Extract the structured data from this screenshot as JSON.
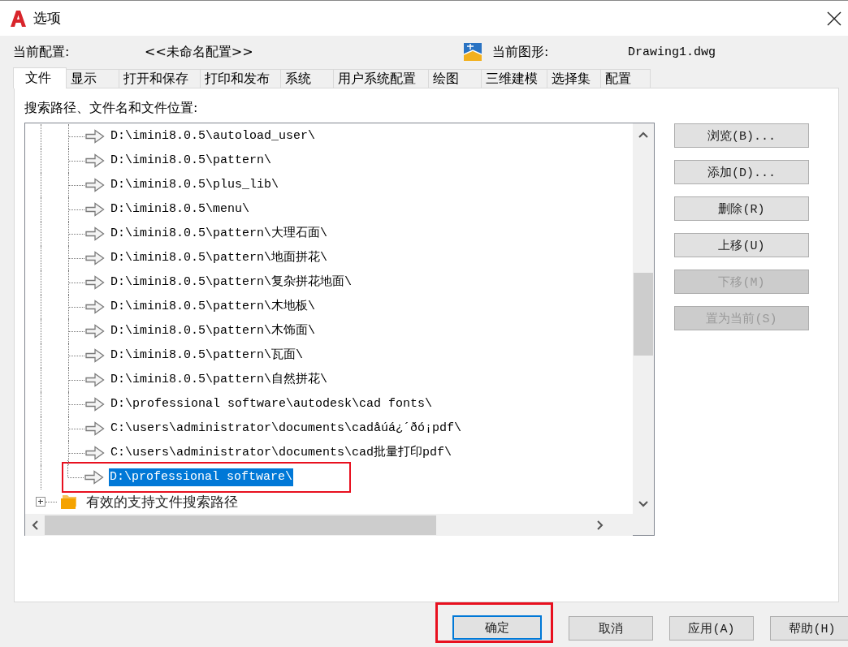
{
  "window": {
    "title": "选项"
  },
  "header": {
    "profile_label": "当前配置:",
    "profile_value": "<<未命名配置>>",
    "drawing_label": "当前图形:",
    "drawing_value": "Drawing1.dwg"
  },
  "tabs": [
    {
      "label": "文件",
      "selected": true
    },
    {
      "label": "显示",
      "selected": false
    },
    {
      "label": "打开和保存",
      "selected": false
    },
    {
      "label": "打印和发布",
      "selected": false
    },
    {
      "label": "系统",
      "selected": false
    },
    {
      "label": "用户系统配置",
      "selected": false
    },
    {
      "label": "绘图",
      "selected": false
    },
    {
      "label": "三维建模",
      "selected": false
    },
    {
      "label": "选择集",
      "selected": false
    },
    {
      "label": "配置",
      "selected": false
    }
  ],
  "panel_label": "搜索路径、文件名和文件位置:",
  "tree": {
    "items": [
      {
        "kind": "continued",
        "children": [
          {
            "label": "D:\\imini8.0.5\\autoload_user\\",
            "selected": false,
            "marked": false
          },
          {
            "label": "D:\\imini8.0.5\\pattern\\",
            "selected": false,
            "marked": false
          },
          {
            "label": "D:\\imini8.0.5\\plus_lib\\",
            "selected": false,
            "marked": false
          },
          {
            "label": "D:\\imini8.0.5\\menu\\",
            "selected": false,
            "marked": false
          },
          {
            "label": "D:\\imini8.0.5\\pattern\\大理石面\\",
            "selected": false,
            "marked": false
          },
          {
            "label": "D:\\imini8.0.5\\pattern\\地面拼花\\",
            "selected": false,
            "marked": false
          },
          {
            "label": "D:\\imini8.0.5\\pattern\\复杂拼花地面\\",
            "selected": false,
            "marked": false
          },
          {
            "label": "D:\\imini8.0.5\\pattern\\木地板\\",
            "selected": false,
            "marked": false
          },
          {
            "label": "D:\\imini8.0.5\\pattern\\木饰面\\",
            "selected": false,
            "marked": false
          },
          {
            "label": "D:\\imini8.0.5\\pattern\\瓦面\\",
            "selected": false,
            "marked": false
          },
          {
            "label": "D:\\imini8.0.5\\pattern\\自然拼花\\",
            "selected": false,
            "marked": false
          },
          {
            "label": "D:\\professional software\\autodesk\\cad fonts\\",
            "selected": false,
            "marked": false
          },
          {
            "label": "C:\\users\\administrator\\documents\\cadåúá¿´ðó¡pdf\\",
            "selected": false,
            "marked": false
          },
          {
            "label": "C:\\users\\administrator\\documents\\cad批量打印pdf\\",
            "selected": false,
            "marked": false
          },
          {
            "label": "D:\\professional software\\",
            "selected": true,
            "marked": true
          }
        ]
      },
      {
        "kind": "folder",
        "label": "有效的支持文件搜索路径",
        "expanded": false
      }
    ]
  },
  "side_buttons": [
    {
      "label": "浏览(B)...",
      "disabled": false
    },
    {
      "label": "添加(D)...",
      "disabled": false
    },
    {
      "label": "删除(R)",
      "disabled": false
    },
    {
      "label": "上移(U)",
      "disabled": false
    },
    {
      "label": "下移(M)",
      "disabled": true
    },
    {
      "label": "置为当前(S)",
      "disabled": true
    }
  ],
  "footer_buttons": [
    {
      "label": "确定",
      "default": true,
      "marked": true
    },
    {
      "label": "取消",
      "default": false,
      "marked": false
    },
    {
      "label": "应用(A)",
      "default": false,
      "marked": false
    },
    {
      "label": "帮助(H)",
      "default": false,
      "marked": false
    }
  ]
}
